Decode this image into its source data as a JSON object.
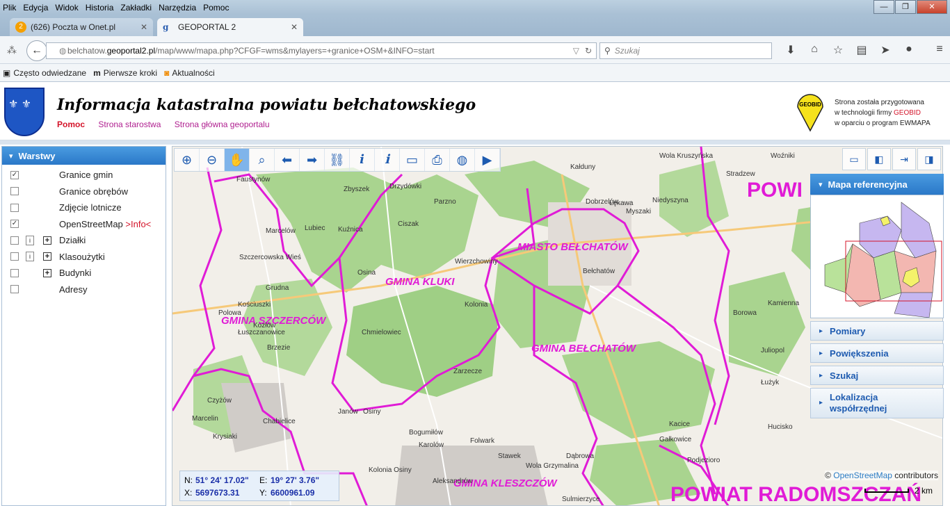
{
  "browser": {
    "menu": [
      "Plik",
      "Edycja",
      "Widok",
      "Historia",
      "Zakładki",
      "Narzędzia",
      "Pomoc"
    ],
    "tabs": [
      {
        "badge": "2",
        "label": "(626) Poczta w Onet.pl"
      },
      {
        "favicon": "g",
        "label": "GEOPORTAL 2"
      }
    ],
    "url_host": "belchatow.",
    "url_domain": "geoportal2.pl",
    "url_path": "/map/www/mapa.php?CFGF=wms&mylayers=+granice+OSM+&INFO=start",
    "search_placeholder": "Szukaj",
    "bookmarks": [
      "Często odwiedzane",
      "Pierwsze kroki",
      "Aktualności"
    ]
  },
  "header": {
    "title": "Informacja katastralna powiatu bełchatowskiego",
    "links": {
      "help": "Pomoc",
      "starostwo": "Strona starostwa",
      "main": "Strona główna geoportalu"
    },
    "geobid_logo_text": "GEOBID",
    "credit_line1": "Strona została przygotowana",
    "credit_line2_prefix": "w technologii firmy ",
    "credit_line2_brand": "GEOBID",
    "credit_line3": "w oparciu o program EWMAPA"
  },
  "layers_panel": {
    "title": "Warstwy",
    "items": [
      {
        "label": "Granice gmin",
        "checked": "✓"
      },
      {
        "label": "Granice obrębów",
        "checked": ""
      },
      {
        "label": "Zdjęcie lotnicze",
        "checked": ""
      },
      {
        "label": "OpenStreetMap",
        "checked": "✓",
        "extra": ">Info<"
      },
      {
        "label": "Działki",
        "checked": "",
        "info": "i",
        "expand": "+"
      },
      {
        "label": "Klasoużytki",
        "checked": "",
        "info": "i",
        "expand": "+"
      },
      {
        "label": "Budynki",
        "checked": "",
        "expand": "+"
      },
      {
        "label": "Adresy",
        "checked": ""
      }
    ]
  },
  "right_panel": {
    "ref_map_title": "Mapa referencyjna",
    "sections": [
      "Pomiary",
      "Powiększenia",
      "Szukaj"
    ],
    "section_tall_line1": "Lokalizacja",
    "section_tall_line2": "współrzędnej"
  },
  "coords": {
    "n_label": "N:",
    "n_value": "51° 24' 17.02\"",
    "e_label": "E:",
    "e_value": "19° 27' 3.76\"",
    "x_label": "X:",
    "x_value": "5697673.31",
    "y_label": "Y:",
    "y_value": "6600961.09"
  },
  "attribution": {
    "prefix": "© ",
    "link": "OpenStreetMap",
    "suffix": " contributors"
  },
  "scale": "2 km",
  "map_labels": {
    "gmina_kluki": "GMINA KLUKI",
    "gmina_szczercow": "GMINA SZCZERCÓW",
    "miasto_belchatow": "MIASTO BEŁCHATÓW",
    "gmina_belchatow": "GMINA BEŁCHATÓW",
    "gmina_kleszczow": "GMINA KLESZCZÓW",
    "powiat_top": "POWI",
    "powiat_radomszczanski": "POWIAT RADOMSZCZAŃ"
  },
  "towns": [
    "Faustynów",
    "Zbyszek",
    "Drzydówki",
    "Parzno",
    "Kałduny",
    "Wola Kruszyńska",
    "Stradzew",
    "Woźniki",
    "Szczercowska Wieś",
    "Marcelów",
    "Lubiec",
    "Kuźnica",
    "Ciszak",
    "Łękawa",
    "Dobrzelów",
    "Myszaki",
    "Niedyszyna",
    "Wierzchowiny",
    "Osina",
    "Bełchatów",
    "Kolonia",
    "Gałkowice",
    "Chmielowiec",
    "Zarzecze",
    "Osiny",
    "Kolonia Osiny",
    "Polowa",
    "Kościuszki",
    "Grudna",
    "Łuszczanowice",
    "Kozłów",
    "Brzezie",
    "Dąbrowa",
    "Wola Grzymalina",
    "Stawek",
    "Folwark",
    "Janów",
    "Bogumiłów",
    "Karolów",
    "Czyżów",
    "Aleksandrów",
    "Marcelin",
    "Krysiaki",
    "Chabielice",
    "Sulmierzyce",
    "Kamienna",
    "Borowa",
    "Juliopol",
    "Łużyk",
    "Hucisko",
    "Kacice",
    "Podjezioro"
  ]
}
